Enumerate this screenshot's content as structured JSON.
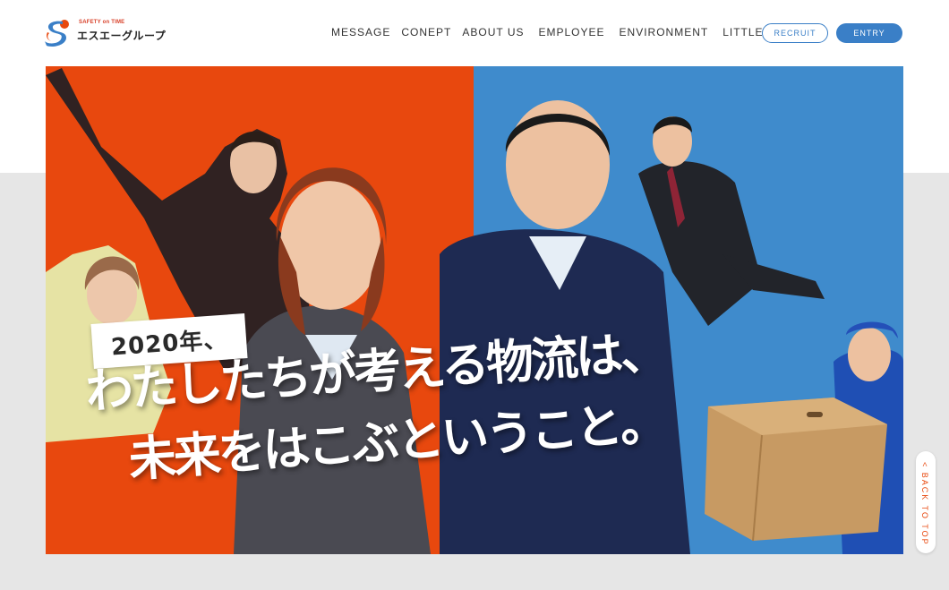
{
  "brand": {
    "tagline": "SAFETY on TIME",
    "name": "エスエーグループ",
    "accent_red": "#e8480e",
    "accent_blue": "#3a7fc7"
  },
  "nav": {
    "items": [
      {
        "label": "MESSAGE"
      },
      {
        "label": "CONEPT"
      },
      {
        "label": "ABOUT US"
      },
      {
        "label": "EMPLOYEE"
      },
      {
        "label": "ENVIRONMENT"
      },
      {
        "label": "LITTLE SUM UP"
      }
    ],
    "recruit_label": "RECRUIT",
    "entry_label": "ENTRY"
  },
  "hero": {
    "year": "2020年、",
    "line1": "わたしたちが考える物流は、",
    "line2": "未来をはこぶということ。",
    "left_color": "#e8480e",
    "right_color": "#3f8bcc"
  },
  "back_to_top": {
    "label": "< BACK TO TOP"
  }
}
